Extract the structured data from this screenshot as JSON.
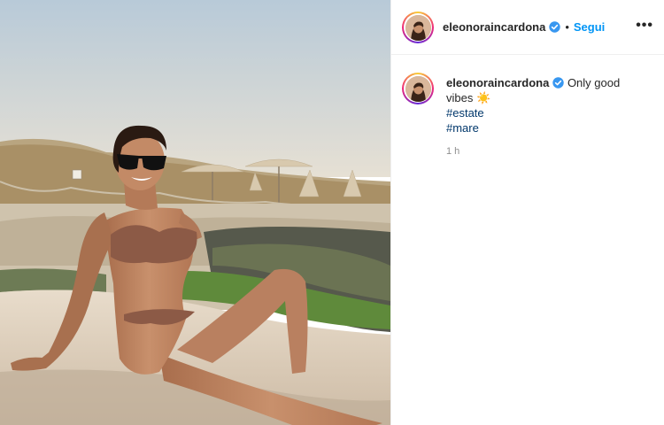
{
  "post": {
    "username": "eleonoraincardona",
    "verified": true,
    "follow_label": "Segui",
    "more_label": "•••",
    "caption": {
      "username": "eleonoraincardona",
      "text": "Only good vibes",
      "emoji": "☀️",
      "hashtags": [
        "#estate",
        "#mare"
      ]
    },
    "time_ago": "1 h"
  },
  "colors": {
    "link": "#0095f6",
    "hashtag": "#00376b",
    "verified": "#3897f0",
    "muted": "#8e8e8e"
  },
  "icons": [
    "verified-badge-icon",
    "sun-emoji-icon",
    "more-options-icon"
  ]
}
